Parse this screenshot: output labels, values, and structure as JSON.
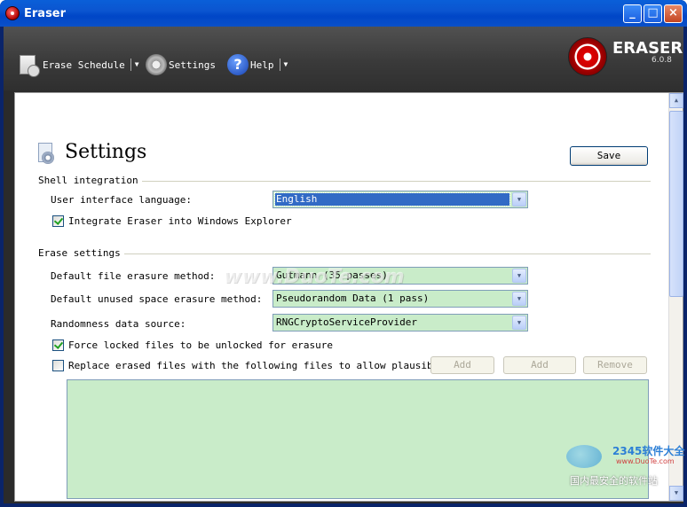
{
  "window": {
    "title": "Eraser"
  },
  "toolbar": {
    "erase_schedule": "Erase Schedule",
    "settings": "Settings",
    "help": "Help"
  },
  "logo": {
    "name": "ERASER",
    "version": "6.0.8"
  },
  "page": {
    "title": "Settings",
    "save_label": "Save"
  },
  "shell_integration": {
    "title": "Shell integration",
    "language_label": "User interface language:",
    "language_value": "English",
    "integrate_label": "Integrate Eraser into Windows Explorer",
    "integrate_checked": true
  },
  "erase_settings": {
    "title": "Erase settings",
    "file_method_label": "Default file erasure method:",
    "file_method_value": "Gutmann (35 passes)",
    "unused_method_label": "Default unused space erasure method:",
    "unused_method_value": "Pseudorandom Data (1 pass)",
    "random_label": "Randomness data source:",
    "random_value": "RNGCryptoServiceProvider",
    "force_unlock_label": "Force locked files to be unlocked for erasure",
    "force_unlock_checked": true,
    "plausible_label": "Replace erased files with the following files to allow plausible den",
    "plausible_checked": false,
    "add_button_1": "Add",
    "add_button_2": "Add",
    "remove_button": "Remove"
  },
  "watermarks": {
    "center": "www.DuoTe.com",
    "brand": "2345软件大全",
    "url": "www.DuoTe.com",
    "cn": "国内最安全的软件站"
  },
  "colors": {
    "accent": "#0054e3",
    "combo_bg": "#c9ecc9",
    "header_band": "#3a3a3a"
  }
}
